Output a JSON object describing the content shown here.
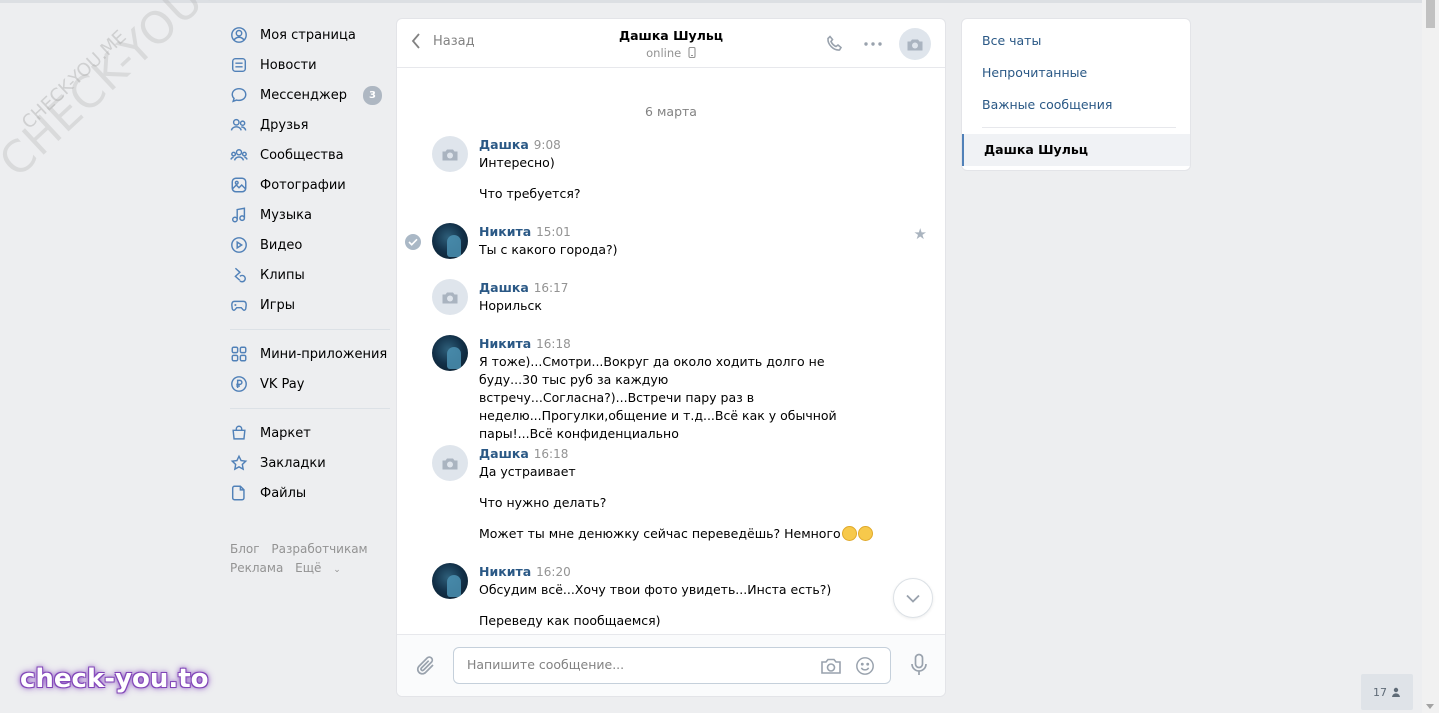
{
  "nav": {
    "items": [
      {
        "label": "Моя страница",
        "icon": "user-icon"
      },
      {
        "label": "Новости",
        "icon": "news-icon"
      },
      {
        "label": "Мессенджер",
        "icon": "messenger-icon",
        "badge": "3"
      },
      {
        "label": "Друзья",
        "icon": "friends-icon"
      },
      {
        "label": "Сообщества",
        "icon": "communities-icon"
      },
      {
        "label": "Фотографии",
        "icon": "photos-icon"
      },
      {
        "label": "Музыка",
        "icon": "music-icon"
      },
      {
        "label": "Видео",
        "icon": "video-icon"
      },
      {
        "label": "Клипы",
        "icon": "clips-icon"
      },
      {
        "label": "Игры",
        "icon": "games-icon"
      },
      {
        "label": "Мини-приложения",
        "icon": "apps-icon"
      },
      {
        "label": "VK Pay",
        "icon": "vkpay-icon"
      },
      {
        "label": "Маркет",
        "icon": "market-icon"
      },
      {
        "label": "Закладки",
        "icon": "bookmark-icon"
      },
      {
        "label": "Файлы",
        "icon": "files-icon"
      }
    ],
    "footer": {
      "blog": "Блог",
      "dev": "Разработчикам",
      "ads": "Реклама",
      "more": "Ещё"
    }
  },
  "chat": {
    "back_label": "Назад",
    "peer_name": "Дашка Шульц",
    "peer_status": "online",
    "date_separator": "6 марта",
    "messages": [
      {
        "author": "Дашка",
        "time": "9:08",
        "texts": [
          "Интересно)",
          "Что требуется?"
        ]
      },
      {
        "author": "Никита",
        "time": "15:01",
        "texts": [
          "Ты с какого города?)"
        ]
      },
      {
        "author": "Дашка",
        "time": "16:17",
        "texts": [
          "Норильск"
        ]
      },
      {
        "author": "Никита",
        "time": "16:18",
        "texts": [
          "Я тоже)...Смотри...Вокруг да около ходить долго не буду...30 тыс руб за каждую встречу...Согласна?)...Встречи пару раз в неделю...Прогулки,общение и т.д...Всё как у обычной пары!...Всё конфиденциально"
        ]
      },
      {
        "author": "Дашка",
        "time": "16:18",
        "texts": [
          "Да устраивает",
          "Что нужно делать?",
          "Может ты мне денюжку сейчас переведёшь? Немного"
        ]
      },
      {
        "author": "Никита",
        "time": "16:20",
        "texts": [
          "Обсудим всё...Хочу твои фото увидеть...Инста есть?)",
          "Переведу как пообщаемся)"
        ]
      }
    ],
    "composer_placeholder": "Напишите сообщение..."
  },
  "right_panel": {
    "all_chats": "Все чаты",
    "unread": "Непрочитанные",
    "important": "Важные сообщения",
    "active_chat": "Дашка Шульц"
  },
  "watermark": {
    "big": "CHECK-YOU.ME",
    "small": "CHECK-YOU.ME",
    "brand": "check-you.to"
  },
  "online_widget": {
    "count": "17"
  },
  "colors": {
    "accent": "#5181b8",
    "link": "#2a5885",
    "background": "#edeef0"
  }
}
